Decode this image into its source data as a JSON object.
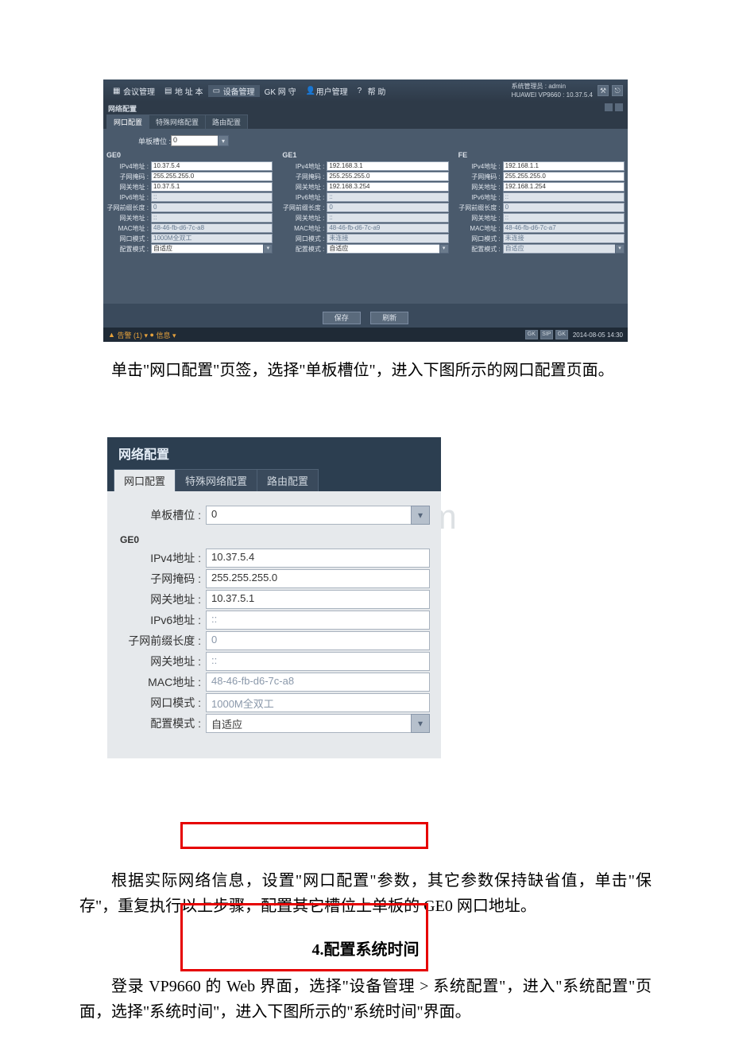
{
  "screenshot1": {
    "sysadmin_label": "系统管理员 : admin",
    "device_label": "HUAWEI VP9660 : 10.37.5.4",
    "menu": {
      "meeting": "会议管理",
      "addrbook": "地 址 本",
      "device": "设备管理",
      "gk": "GK 网 守",
      "user": "用户管理",
      "help": "帮   助"
    },
    "section_title": "网络配置",
    "tabs": {
      "net": "网口配置",
      "special": "特殊网络配置",
      "route": "路由配置"
    },
    "slot_label": "单板槽位 :",
    "slot_value": "0",
    "columns": {
      "GE0": {
        "title": "GE0",
        "ipv4_addr": "10.37.5.4",
        "subnet": "255.255.255.0",
        "gateway": "10.37.5.1",
        "ipv6": "::",
        "prefix": "0",
        "gw6": "::",
        "mac": "48-46-fb-d6-7c-a8",
        "mode": "1000M全双工",
        "cfgmode": "自适应"
      },
      "GE1": {
        "title": "GE1",
        "ipv4_addr": "192.168.3.1",
        "subnet": "255.255.255.0",
        "gateway": "192.168.3.254",
        "ipv6": "::",
        "prefix": "0",
        "gw6": "::",
        "mac": "48-46-fb-d6-7c-a9",
        "mode": "未连接",
        "cfgmode": "自适应"
      },
      "FE": {
        "title": "FE",
        "ipv4_addr": "192.168.1.1",
        "subnet": "255.255.255.0",
        "gateway": "192.168.1.254",
        "ipv6": "::",
        "prefix": "0",
        "gw6": "::",
        "mac": "48-46-fb-d6-7c-a7",
        "mode": "未连接",
        "cfgmode": "自适应"
      }
    },
    "labels": {
      "ipv4_addr": "IPv4地址 :",
      "subnet": "子网掩码 :",
      "gateway": "网关地址 :",
      "ipv6": "IPv6地址 :",
      "prefix": "子网前缀长度 :",
      "gw6": "网关地址 :",
      "mac": "MAC地址 :",
      "mode": "网口模式 :",
      "cfgmode": "配置模式 :"
    },
    "save_btn": "保存",
    "refresh_btn": "刷新",
    "alert_text": "告警 (1) ▾",
    "info_text": "信息 ▾",
    "warn_icon": "▲",
    "info_icon": "●",
    "badge_gk": "GK",
    "badge_sip": "SIP",
    "badge_gk2": "GK",
    "timestamp": "2014-08-05 14:30"
  },
  "paragraph1": "单击\"网口配置\"页签，选择\"单板槽位\"，进入下图所示的网口配置页面。",
  "screenshot2": {
    "title": "网络配置",
    "tabs": {
      "net": "网口配置",
      "special": "特殊网络配置",
      "route": "路由配置"
    },
    "slot_label": "单板槽位 :",
    "slot_value": "0",
    "ge_title": "GE0",
    "labels": {
      "ipv4_addr": "IPv4地址 :",
      "subnet": "子网掩码 :",
      "gateway": "网关地址 :",
      "ipv6": "IPv6地址 :",
      "prefix": "子网前缀长度 :",
      "gw6": "网关地址 :",
      "mac": "MAC地址 :",
      "mode": "网口模式 :",
      "cfgmode": "配置模式 :"
    },
    "values": {
      "ipv4_addr": "10.37.5.4",
      "subnet": "255.255.255.0",
      "gateway": "10.37.5.1",
      "ipv6": "::",
      "prefix": "0",
      "gw6": "::",
      "mac": "48-46-fb-d6-7c-a8",
      "mode": "1000M全双工",
      "cfgmode": "自适应"
    },
    "watermark": "www.bdocx.com"
  },
  "paragraph2": "根据实际网络信息，设置\"网口配置\"参数，其它参数保持缺省值，单击\"保存\"，重复执行以上步骤，配置其它槽位上单板的 GE0 网口地址。",
  "heading4": "4.配置系统时间",
  "paragraph3": "登录 VP9660 的 Web 界面，选择\"设备管理 > 系统配置\"，进入\"系统配置\"页面，选择\"系统时间\"，进入下图所示的\"系统时间\"界面。"
}
